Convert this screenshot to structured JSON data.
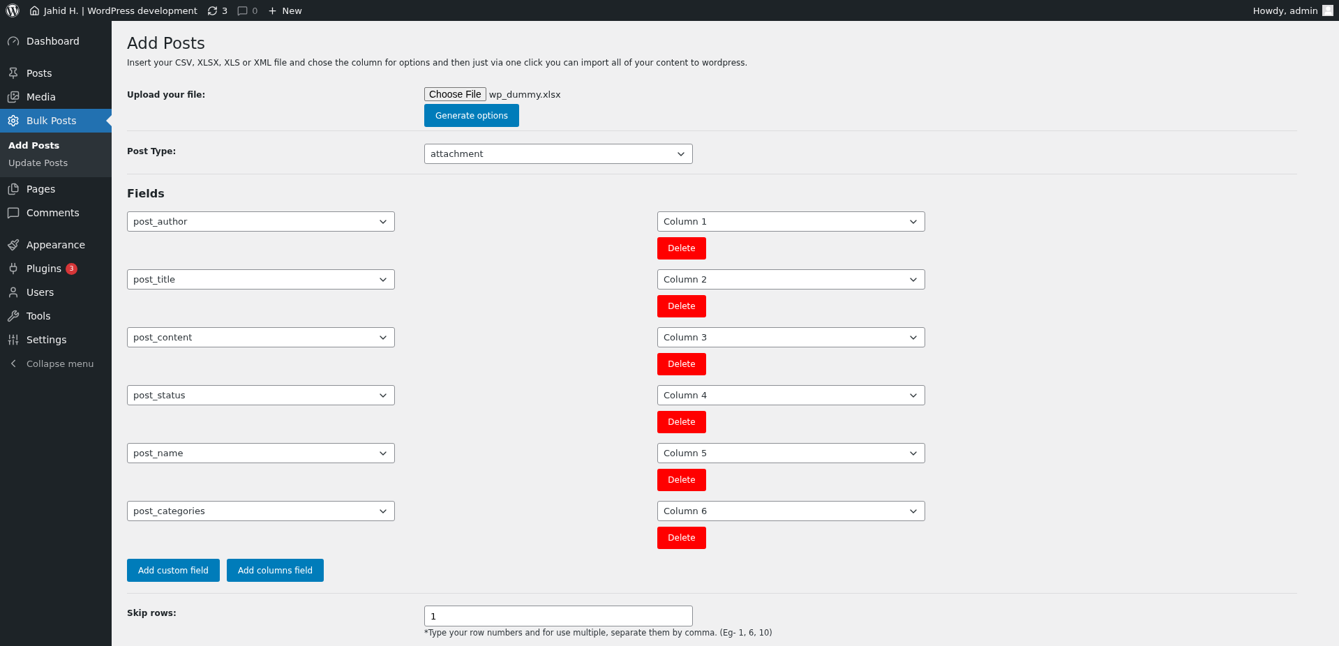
{
  "admin_bar": {
    "site_title": "Jahid H. | WordPress development",
    "updates_count": "3",
    "comments_count": "0",
    "new_label": "New",
    "greeting": "Howdy, admin"
  },
  "sidebar": {
    "items": [
      {
        "label": "Dashboard",
        "selected": false
      },
      {
        "label": "Posts",
        "selected": false
      },
      {
        "label": "Media",
        "selected": false
      },
      {
        "label": "Bulk Posts",
        "selected": true,
        "children": [
          {
            "label": "Add Posts",
            "selected": true
          },
          {
            "label": "Update Posts",
            "selected": false
          }
        ]
      },
      {
        "label": "Pages",
        "selected": false
      },
      {
        "label": "Comments",
        "selected": false
      },
      {
        "label": "Appearance",
        "selected": false
      },
      {
        "label": "Plugins",
        "selected": false,
        "badge": "3"
      },
      {
        "label": "Users",
        "selected": false
      },
      {
        "label": "Tools",
        "selected": false
      },
      {
        "label": "Settings",
        "selected": false
      }
    ],
    "collapse_label": "Collapse menu"
  },
  "page": {
    "title": "Add Posts",
    "description": "Insert your CSV, XLSX, XLS or XML file and chose the column for options and then just via one click you can import all of your content to wordpress.",
    "upload": {
      "label": "Upload your file:",
      "choose_button": "Choose File",
      "file_name": "wp_dummy.xlsx",
      "generate_button": "Generate options"
    },
    "post_type": {
      "label": "Post Type:",
      "value": "attachment"
    },
    "fields_heading": "Fields",
    "fields": [
      {
        "field": "post_author",
        "column": "Column 1",
        "delete_button": "Delete"
      },
      {
        "field": "post_title",
        "column": "Column 2",
        "delete_button": "Delete"
      },
      {
        "field": "post_content",
        "column": "Column 3",
        "delete_button": "Delete"
      },
      {
        "field": "post_status",
        "column": "Column 4",
        "delete_button": "Delete"
      },
      {
        "field": "post_name",
        "column": "Column 5",
        "delete_button": "Delete"
      },
      {
        "field": "post_categories",
        "column": "Column 6",
        "delete_button": "Delete"
      }
    ],
    "add_buttons": [
      "Add custom field",
      "Add columns field"
    ],
    "skip_rows": {
      "label": "Skip rows:",
      "value": "1",
      "hint": "*Type your row numbers and for use multiple, separate them by comma. (Eg- 1, 6, 10)"
    }
  }
}
